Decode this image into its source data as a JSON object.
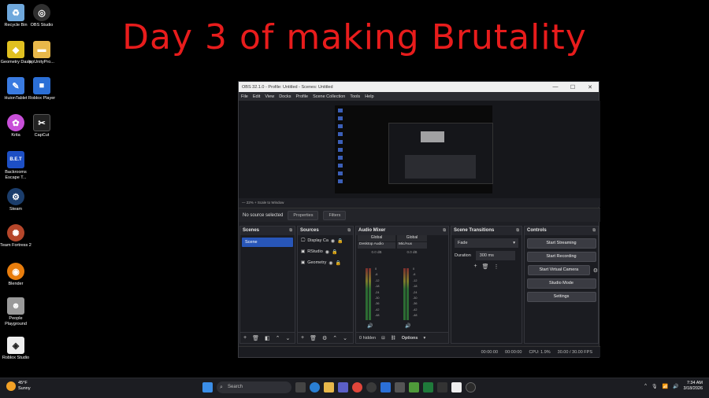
{
  "overlay_title": "Day 3 of making Brutality",
  "desktop_icons": [
    {
      "label": "Recycle Bin",
      "icon": "recycle-bin-icon",
      "color": "#6fa8dc"
    },
    {
      "label": "OBS Studio",
      "icon": "obs-icon",
      "color": "#303030"
    },
    {
      "label": "Geometry Dash",
      "icon": "geometry-dash-icon",
      "color": "#e0c020"
    },
    {
      "label": "ppUnityPro...",
      "icon": "folder-icon",
      "color": "#e8b84a"
    },
    {
      "label": "HuionTablet",
      "icon": "huion-icon",
      "color": "#3a7be0"
    },
    {
      "label": "Roblox Player",
      "icon": "roblox-player-icon",
      "color": "#2b6fd6"
    },
    {
      "label": "Krita",
      "icon": "krita-icon",
      "color": "#c84fd8"
    },
    {
      "label": "CapCut",
      "icon": "capcut-icon",
      "color": "#222222"
    },
    {
      "label": "Backrooms Escape T...",
      "icon": "backrooms-icon",
      "color": "#1d4fc4"
    },
    {
      "label": "Steam",
      "icon": "steam-icon",
      "color": "#1b3d6b"
    },
    {
      "label": "Team Fortress 2",
      "icon": "tf2-icon",
      "color": "#b5462a"
    },
    {
      "label": "Blender",
      "icon": "blender-icon",
      "color": "#e87d0d"
    },
    {
      "label": "People Playground",
      "icon": "people-playground-icon",
      "color": "#9a9a9a"
    },
    {
      "label": "Roblox Studio",
      "icon": "roblox-studio-icon",
      "color": "#eeeeee"
    }
  ],
  "obs": {
    "title": "OBS 32.1.0 - Profile: Untitled - Scenes: Untitled",
    "window_controls": [
      "—",
      "☐",
      "✕"
    ],
    "menu": [
      "File",
      "Edit",
      "View",
      "Docks",
      "Profile",
      "Scene Collection",
      "Tools",
      "Help"
    ],
    "zoom": "— 22% + Scale to Window",
    "source_bar": {
      "status": "No source selected",
      "properties": "Properties",
      "filters": "Filters"
    },
    "scenes": {
      "header": "Scenes",
      "items": [
        "Scene"
      ]
    },
    "sources": {
      "header": "Sources",
      "items": [
        "Display Ca",
        "RStudio",
        "Geometry"
      ]
    },
    "mixer": {
      "header": "Audio Mixer",
      "channels": [
        {
          "group": "Global",
          "device": "Desktop Audio",
          "db": "0.0 dB"
        },
        {
          "group": "Global",
          "device": "Mic/Aux",
          "db": "0.0 dB"
        }
      ],
      "scale": [
        "0",
        "-6",
        "-12",
        "-18",
        "-24",
        "-30",
        "-36",
        "-42",
        "-48",
        "-54",
        "-60"
      ],
      "footer": {
        "hidden": "0 hidden",
        "options": "Options"
      }
    },
    "transitions": {
      "header": "Scene Transitions",
      "type": "Fade",
      "duration_label": "Duration",
      "duration": "300 ms"
    },
    "controls": {
      "header": "Controls",
      "start_streaming": "Start Streaming",
      "start_recording": "Start Recording",
      "start_virtual_camera": "Start Virtual Camera",
      "studio_mode": "Studio Mode",
      "settings": "Settings"
    },
    "status": {
      "stream_time": "00:00:00",
      "rec_time": "00:00:00",
      "cpu": "CPU: 1.9%",
      "fps": "30.00 / 30.00 FPS"
    }
  },
  "taskbar": {
    "weather": {
      "temp": "45°F",
      "condition": "Sunny"
    },
    "search_placeholder": "Search",
    "clock": {
      "time": "7:34 AM",
      "date": "3/18/2026"
    }
  }
}
